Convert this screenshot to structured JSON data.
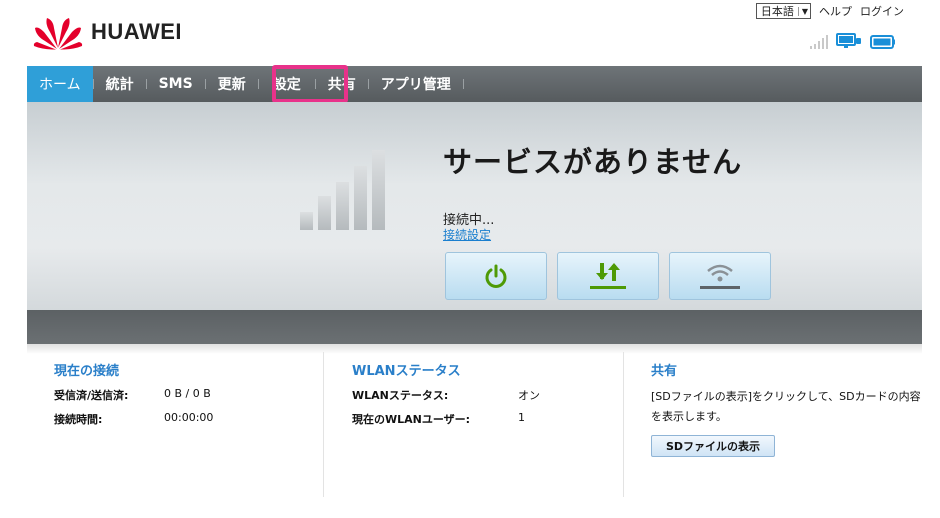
{
  "header": {
    "language_selected": "日本語",
    "help_label": "ヘルプ",
    "login_label": "ログイン",
    "brand": "HUAWEI"
  },
  "nav": {
    "items": [
      {
        "label": "ホーム",
        "active": true
      },
      {
        "label": "統計"
      },
      {
        "label": "SMS"
      },
      {
        "label": "更新"
      },
      {
        "label": "設定",
        "highlighted": true
      },
      {
        "label": "共有"
      },
      {
        "label": "アプリ管理"
      }
    ]
  },
  "hero": {
    "headline": "サービスがありません",
    "status_text": "接続中...",
    "settings_link": "接続設定",
    "buttons": [
      {
        "name": "power-icon"
      },
      {
        "name": "data-transfer-icon"
      },
      {
        "name": "wifi-icon"
      }
    ]
  },
  "current_connection": {
    "title": "現在の接続",
    "rows": [
      {
        "label": "受信済/送信済:",
        "value": "0 B / 0 B"
      },
      {
        "label": "接続時間:",
        "value": "00:00:00"
      }
    ]
  },
  "wlan_status": {
    "title": "WLANステータス",
    "rows": [
      {
        "label": "WLANステータス:",
        "value": "オン"
      },
      {
        "label": "現在のWLANユーザー:",
        "value": "1"
      }
    ]
  },
  "share": {
    "title": "共有",
    "description": "[SDファイルの表示]をクリックして、SDカードの内容を表示します。",
    "button_label": "SDファイルの表示"
  },
  "colors": {
    "accent": "#2f9fd8",
    "highlight": "#e8328a",
    "panel_title": "#2a7fc9",
    "nav_bg": "#5f6467",
    "brand_red": "#e4002b",
    "status_green": "#4e9a06"
  }
}
